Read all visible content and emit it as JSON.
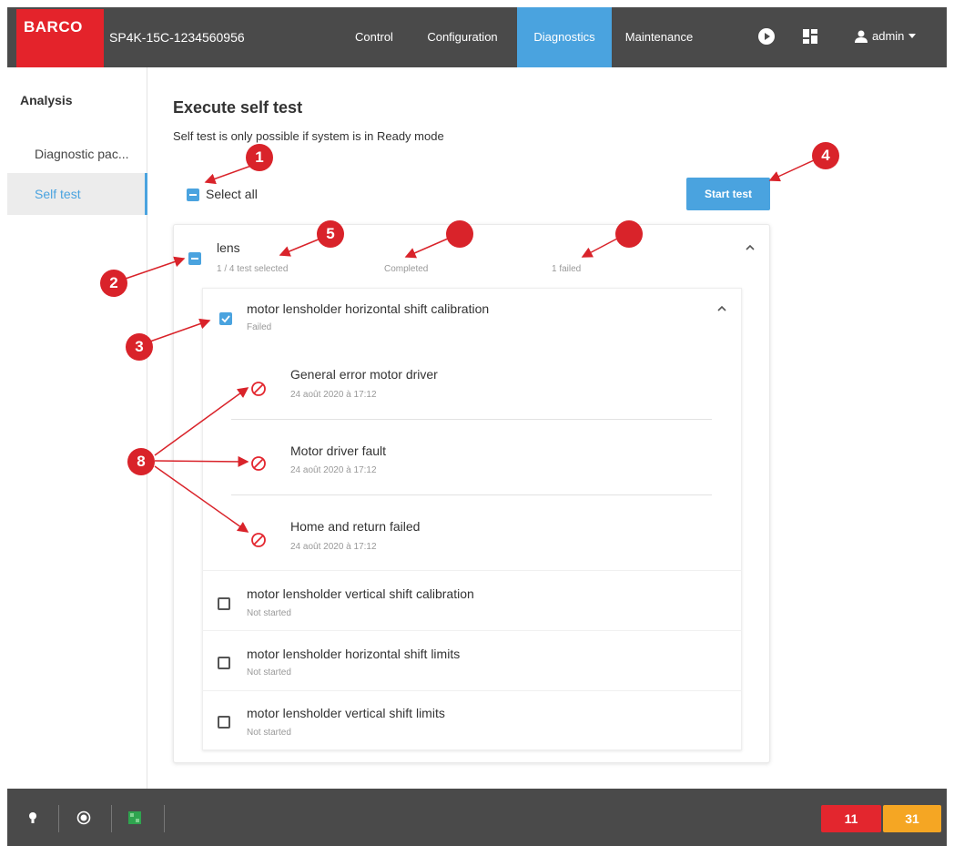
{
  "header": {
    "logo": "BARCO",
    "device": "SP4K-15C-1234560956",
    "nav": [
      "Control",
      "Configuration",
      "Diagnostics",
      "Maintenance"
    ],
    "user": "admin",
    "accent_color": "#4aa3df",
    "brand_color": "#e4232b"
  },
  "sidebar": {
    "heading": "Analysis",
    "items": [
      {
        "label": "Diagnostic pac..."
      },
      {
        "label": "Self test"
      }
    ]
  },
  "main": {
    "title": "Execute self test",
    "subtitle": "Self test is only possible if system is in Ready mode",
    "select_all": "Select all",
    "start_button": "Start test",
    "group": {
      "name": "lens",
      "selected": "1 / 4 test selected",
      "status": "Completed",
      "failed": "1 failed"
    },
    "tests": [
      {
        "name": "motor lensholder horizontal shift calibration",
        "status": "Failed",
        "errors": [
          {
            "title": "General error motor driver",
            "time": "24 août 2020 à 17:12"
          },
          {
            "title": "Motor driver fault",
            "time": "24 août 2020 à 17:12"
          },
          {
            "title": "Home and return failed",
            "time": "24 août 2020 à 17:12"
          }
        ]
      },
      {
        "name": "motor lensholder vertical shift calibration",
        "status": "Not started"
      },
      {
        "name": "motor lensholder horizontal shift limits",
        "status": "Not started"
      },
      {
        "name": "motor lensholder vertical shift limits",
        "status": "Not started"
      }
    ]
  },
  "annotations": {
    "n1": "1",
    "n2": "2",
    "n3": "3",
    "n4": "4",
    "n5": "5",
    "n8": "8"
  },
  "footer": {
    "badge_red": "11",
    "badge_orange": "31",
    "red_color": "#e3262e",
    "orange_color": "#f5a623"
  }
}
